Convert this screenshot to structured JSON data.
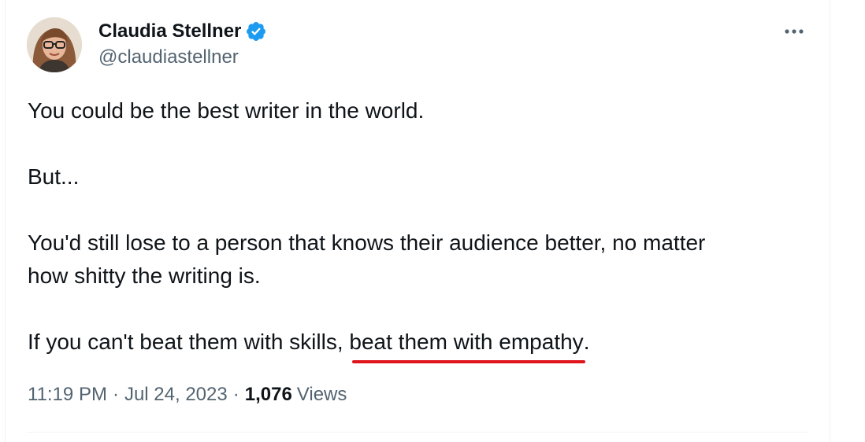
{
  "author": {
    "name": "Claudia Stellner",
    "handle": "@claudiastellner",
    "verified": true,
    "verified_color": "#1d9bf0"
  },
  "menu": {
    "icon": "more-horizontal-icon"
  },
  "tweet": {
    "lines": [
      "You could be the best writer in the world.",
      "But...",
      "You'd still lose to a person that knows their audience better, no matter",
      "how shitty the writing is."
    ],
    "last_line_prefix": "If you can't beat them with skills, ",
    "last_line_emphasis": "beat them with empathy",
    "last_line_suffix": ".",
    "annotation_color": "#e0141b"
  },
  "meta": {
    "time": "11:19 PM",
    "separator": "·",
    "date": "Jul 24, 2023",
    "views_count": "1,076",
    "views_label": "Views"
  }
}
